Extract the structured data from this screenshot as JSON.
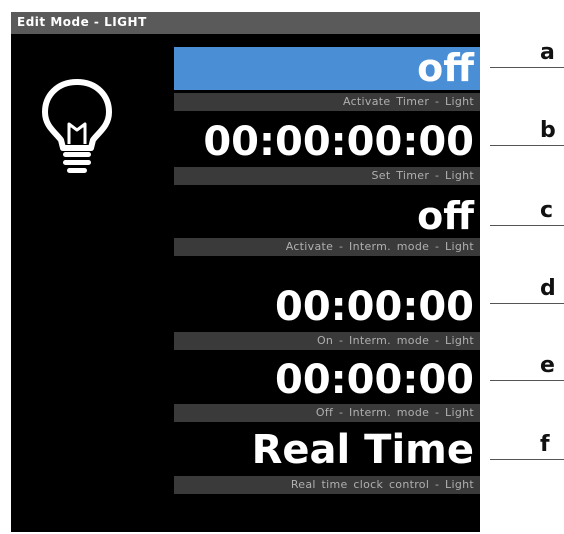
{
  "window": {
    "title": "Edit Mode - LIGHT"
  },
  "icon": "lightbulb-icon",
  "colors": {
    "selected": "#4a8fd6",
    "caption_bg": "#3a3a3a",
    "screen_bg": "#000000"
  },
  "rows": [
    {
      "value": "off",
      "caption": "Activate Timer - Light",
      "callout": "a",
      "selected": true
    },
    {
      "value": "00:00:00:00",
      "caption": "Set Timer - Light",
      "callout": "b"
    },
    {
      "value": "off",
      "caption": "Activate - Interm. mode - Light",
      "callout": "c"
    },
    {
      "value": "00:00:00",
      "caption": "On - Interm. mode - Light",
      "callout": "d"
    },
    {
      "value": "00:00:00",
      "caption": "Off - Interm. mode - Light",
      "callout": "e"
    },
    {
      "value": "Real Time",
      "caption": "Real time clock control - Light",
      "callout": "f"
    }
  ]
}
